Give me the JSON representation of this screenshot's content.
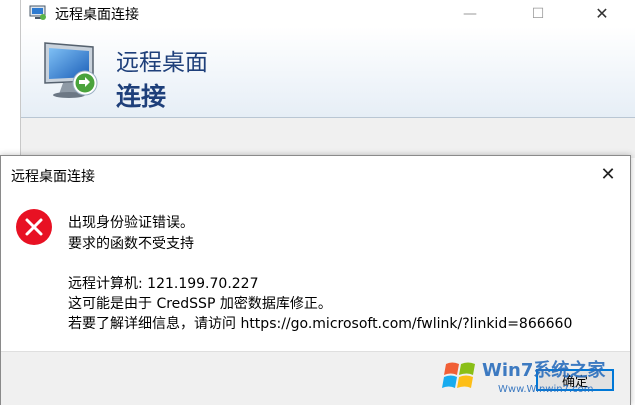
{
  "background_window": {
    "title": "远程桌面连接",
    "banner_line1": "远程桌面",
    "banner_line2": "连接",
    "controls": {
      "minimize": "—",
      "maximize": "☐",
      "close": "✕"
    }
  },
  "dialog": {
    "title": "远程桌面连接",
    "close_glyph": "✕",
    "icon": "error-icon",
    "lines": [
      "出现身份验证错误。",
      "要求的函数不受支持",
      "远程计算机: 121.199.70.227",
      "这可能是由于 CredSSP 加密数据库修正。",
      "若要了解详细信息，请访问 https://go.microsoft.com/fwlink/?linkid=866660"
    ],
    "ok_label": "确定"
  },
  "watermark": {
    "text_top": "Win7系统之家",
    "text_bottom": "Www.Winwin7.com"
  },
  "colors": {
    "accent": "#0078d7",
    "error_red": "#e81123",
    "banner_text": "#1e3f7a"
  }
}
